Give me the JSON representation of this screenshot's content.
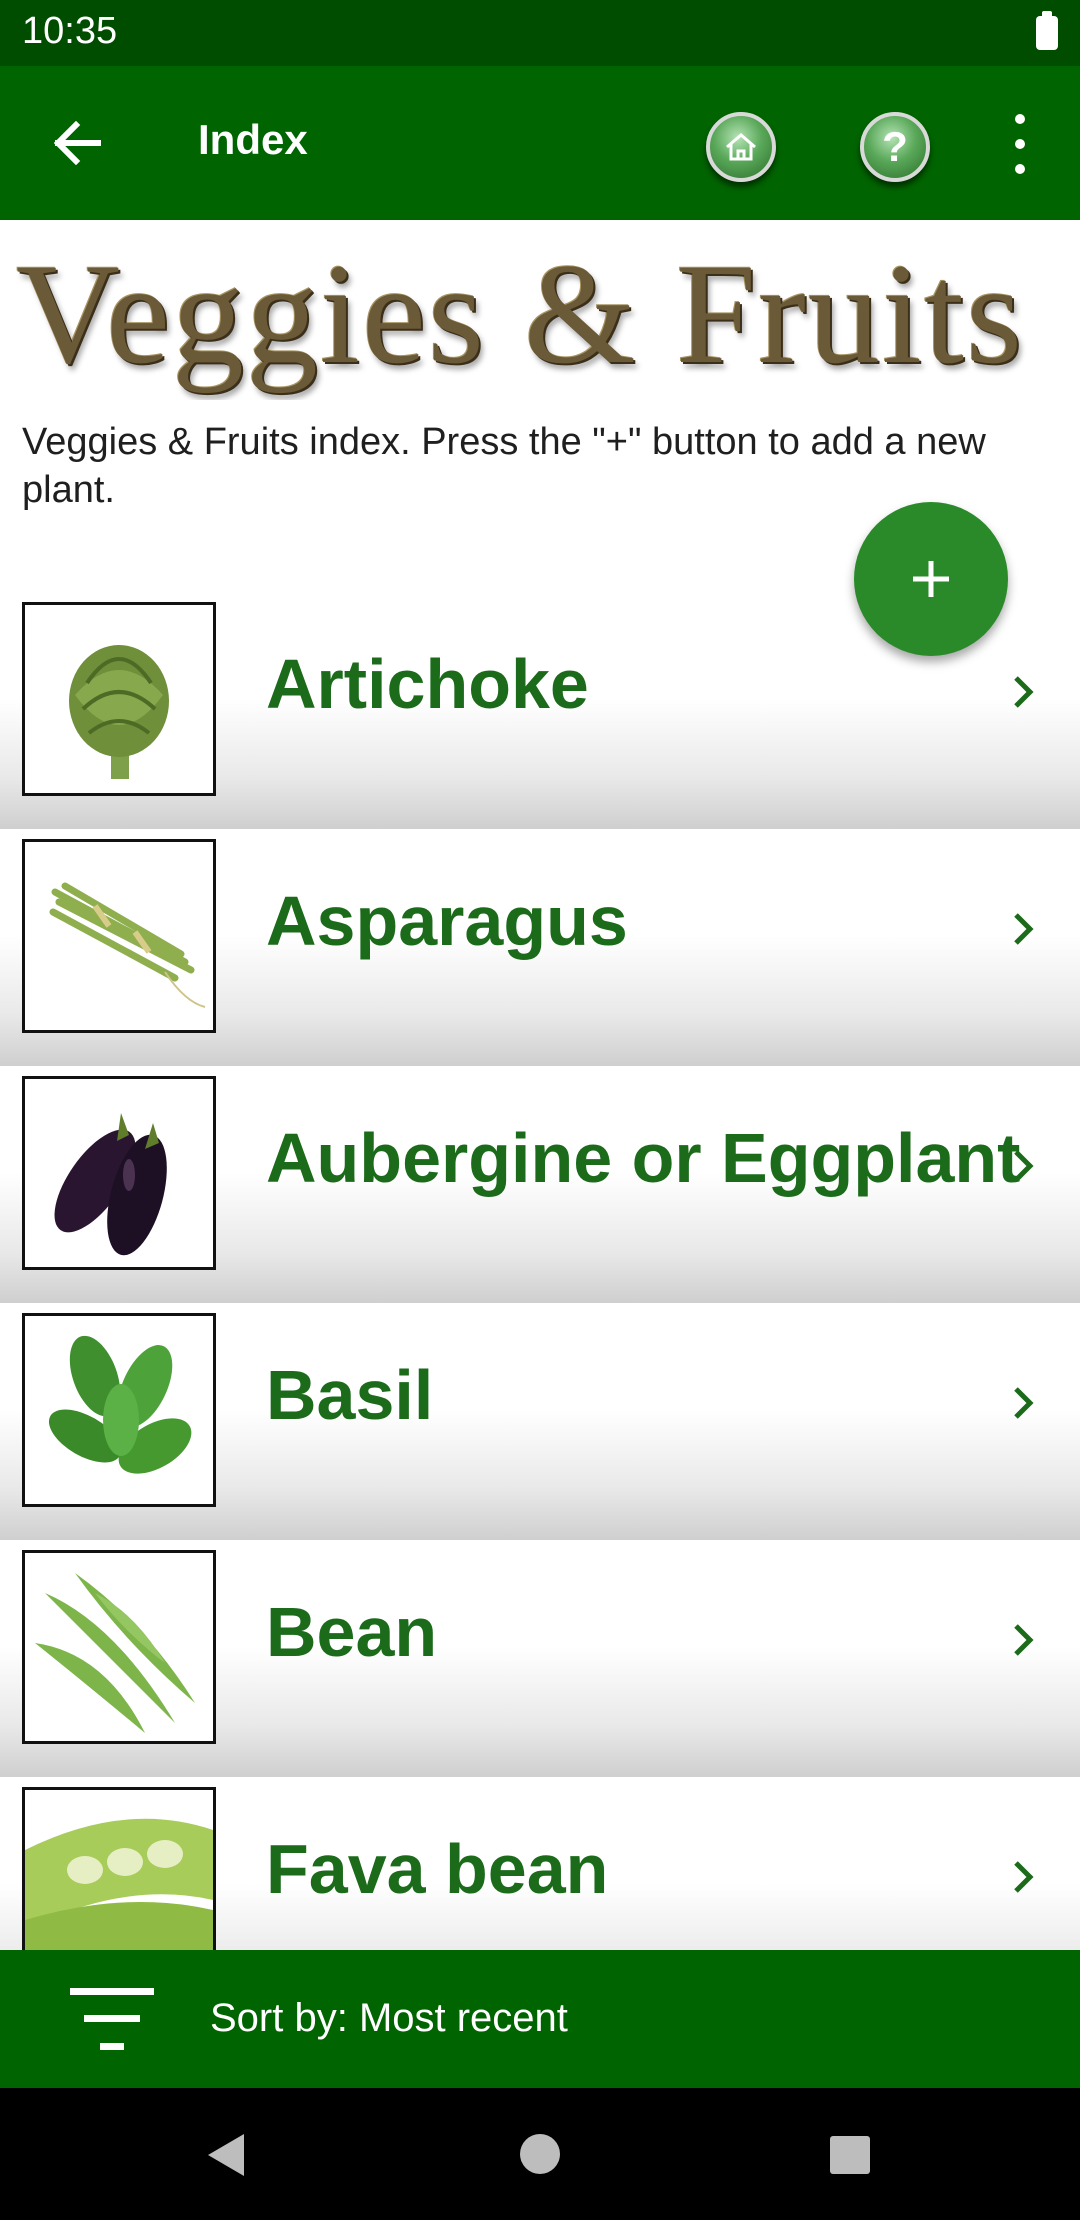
{
  "status_bar": {
    "time": "10:35"
  },
  "app_bar": {
    "title": "Index"
  },
  "banner": {
    "text": "Veggies & Fruits"
  },
  "description": "Veggies & Fruits index. Press the \"+\" button to add a new plant.",
  "items": [
    {
      "label": "Artichoke"
    },
    {
      "label": "Asparagus"
    },
    {
      "label": "Aubergine or Eggplant"
    },
    {
      "label": "Basil"
    },
    {
      "label": "Bean"
    },
    {
      "label": "Fava bean"
    }
  ],
  "sort_bar": {
    "label": "Sort by: Most recent"
  },
  "colors": {
    "primary": "#006400",
    "status": "#004d00",
    "accent": "#2a8a2a",
    "item_text": "#1b6b1b"
  }
}
